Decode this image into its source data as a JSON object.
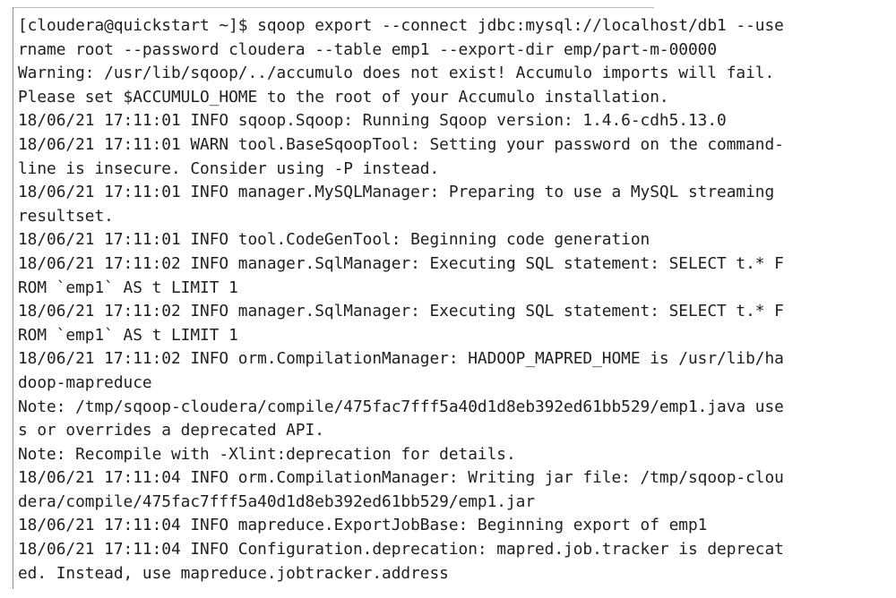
{
  "terminal": {
    "lines": [
      "[cloudera@quickstart ~]$ sqoop export --connect jdbc:mysql://localhost/db1 --use",
      "rname root --password cloudera --table emp1 --export-dir emp/part-m-00000",
      "Warning: /usr/lib/sqoop/../accumulo does not exist! Accumulo imports will fail.",
      "Please set $ACCUMULO_HOME to the root of your Accumulo installation.",
      "18/06/21 17:11:01 INFO sqoop.Sqoop: Running Sqoop version: 1.4.6-cdh5.13.0",
      "18/06/21 17:11:01 WARN tool.BaseSqoopTool: Setting your password on the command-",
      "line is insecure. Consider using -P instead.",
      "18/06/21 17:11:01 INFO manager.MySQLManager: Preparing to use a MySQL streaming",
      "resultset.",
      "18/06/21 17:11:01 INFO tool.CodeGenTool: Beginning code generation",
      "18/06/21 17:11:02 INFO manager.SqlManager: Executing SQL statement: SELECT t.* F",
      "ROM `emp1` AS t LIMIT 1",
      "18/06/21 17:11:02 INFO manager.SqlManager: Executing SQL statement: SELECT t.* F",
      "ROM `emp1` AS t LIMIT 1",
      "18/06/21 17:11:02 INFO orm.CompilationManager: HADOOP_MAPRED_HOME is /usr/lib/ha",
      "doop-mapreduce",
      "Note: /tmp/sqoop-cloudera/compile/475fac7fff5a40d1d8eb392ed61bb529/emp1.java use",
      "s or overrides a deprecated API.",
      "Note: Recompile with -Xlint:deprecation for details.",
      "18/06/21 17:11:04 INFO orm.CompilationManager: Writing jar file: /tmp/sqoop-clou",
      "dera/compile/475fac7fff5a40d1d8eb392ed61bb529/emp1.jar",
      "18/06/21 17:11:04 INFO mapreduce.ExportJobBase: Beginning export of emp1",
      "18/06/21 17:11:04 INFO Configuration.deprecation: mapred.job.tracker is deprecat",
      "ed. Instead, use mapreduce.jobtracker.address"
    ]
  }
}
